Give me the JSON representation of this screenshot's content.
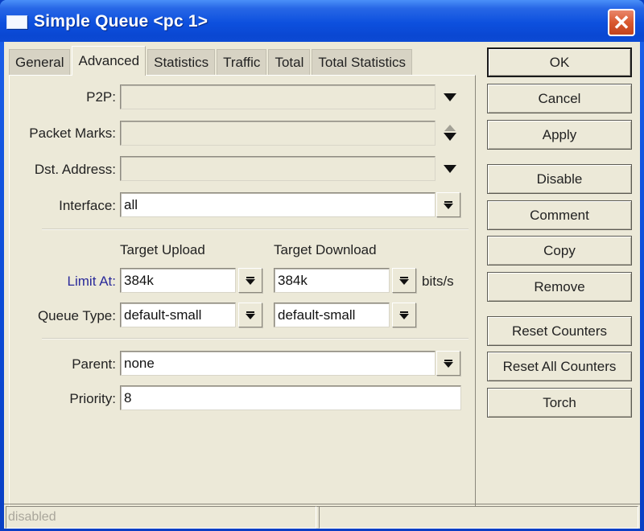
{
  "window": {
    "title": "Simple Queue <pc 1>",
    "close_icon": "close-x-icon"
  },
  "tabs": [
    {
      "label": "General",
      "active": false
    },
    {
      "label": "Advanced",
      "active": true
    },
    {
      "label": "Statistics",
      "active": false
    },
    {
      "label": "Traffic",
      "active": false
    },
    {
      "label": "Total",
      "active": false
    },
    {
      "label": "Total Statistics",
      "active": false
    }
  ],
  "form": {
    "p2p": {
      "label": "P2P:",
      "value": "",
      "icon": "dropdown-arrow-icon"
    },
    "packet_marks": {
      "label": "Packet Marks:",
      "value": "",
      "icon": "add-remove-arrows-icon"
    },
    "dst_address": {
      "label": "Dst. Address:",
      "value": "",
      "icon": "dropdown-arrow-icon"
    },
    "interface": {
      "label": "Interface:",
      "value": "all"
    },
    "target_upload_header": "Target Upload",
    "target_download_header": "Target Download",
    "limit_at": {
      "label": "Limit At:",
      "upload": "384k",
      "download": "384k",
      "unit": "bits/s"
    },
    "queue_type": {
      "label": "Queue Type:",
      "upload": "default-small",
      "download": "default-small"
    },
    "parent": {
      "label": "Parent:",
      "value": "none"
    },
    "priority": {
      "label": "Priority:",
      "value": "8"
    }
  },
  "buttons": {
    "ok": "OK",
    "cancel": "Cancel",
    "apply": "Apply",
    "disable": "Disable",
    "comment": "Comment",
    "copy": "Copy",
    "remove": "Remove",
    "reset_counters": "Reset Counters",
    "reset_all_counters": "Reset All Counters",
    "torch": "Torch"
  },
  "status_bar": {
    "left": "disabled",
    "right": ""
  }
}
